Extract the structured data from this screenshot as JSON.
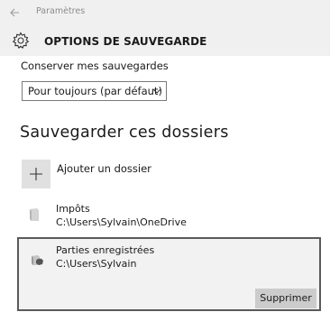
{
  "window": {
    "title": "Paramètres",
    "back_icon": "back-arrow-icon"
  },
  "header": {
    "icon": "gear-icon",
    "title": "OPTIONS DE SAUVEGARDE"
  },
  "keep_backups": {
    "label": "Conserver mes sauvegardes",
    "selected": "Pour toujours (par défaut)"
  },
  "folders_section": {
    "title": "Sauvegarder ces dossiers",
    "add_label": "Ajouter un dossier",
    "items": [
      {
        "name": "Impôts",
        "path": "C:\\Users\\Sylvain\\OneDrive",
        "icon": "folder-icon",
        "selected": false
      },
      {
        "name": "Parties enregistrées",
        "path": "C:\\Users\\Sylvain",
        "icon": "saved-games-icon",
        "selected": true
      }
    ],
    "remove_label": "Supprimer"
  },
  "colors": {
    "header_bg": "#f0f0f0",
    "selected_bg": "#f2f2f2",
    "selected_border": "#5a5a5a",
    "button_bg": "#cccccc",
    "add_button_bg": "#e0e0e0"
  }
}
